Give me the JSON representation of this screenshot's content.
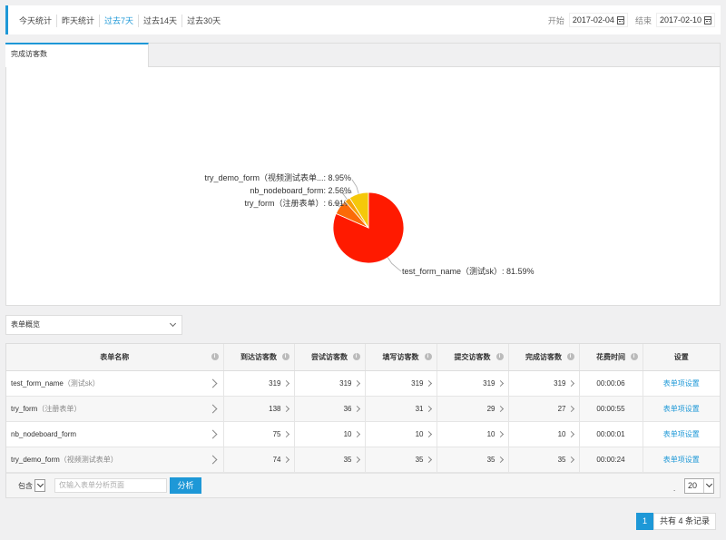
{
  "range_tabs": [
    {
      "label": "今天统计",
      "active": false
    },
    {
      "label": "昨天统计",
      "active": false
    },
    {
      "label": "过去7天",
      "active": true
    },
    {
      "label": "过去14天",
      "active": false
    },
    {
      "label": "过去30天",
      "active": false
    }
  ],
  "date_range": {
    "start_label": "开始",
    "start_value": "2017-02-04",
    "end_label": "结束",
    "end_value": "2017-02-10"
  },
  "chart_tab_label": "完成访客数",
  "chart_data": {
    "type": "pie",
    "slices": [
      {
        "name": "test_form_name（测试sk）",
        "value": 81.59,
        "label": "test_form_name（测试sk）: 81.59%",
        "color": "#ff1a00"
      },
      {
        "name": "try_form（注册表单）",
        "value": 6.91,
        "label": "try_form（注册表单）: 6.91%",
        "color": "#fb6a08"
      },
      {
        "name": "nb_nodeboard_form",
        "value": 2.56,
        "label": "nb_nodeboard_form: 2.56%",
        "color": "#f79f07"
      },
      {
        "name": "try_demo_form（视频测试表单）",
        "value": 8.95,
        "label": "try_demo_form（视频测试表单...: 8.95%",
        "color": "#f5c80a"
      }
    ]
  },
  "table_select": {
    "value": "表单概览"
  },
  "table": {
    "headers": [
      "表单名称",
      "到达访客数",
      "尝试访客数",
      "填写访客数",
      "提交访客数",
      "完成访客数",
      "花费时间",
      "设置"
    ],
    "rows": [
      {
        "name": "test_form_name",
        "tag": "（测试sk）",
        "reach": "319",
        "try": "319",
        "fill": "319",
        "submit": "319",
        "complete": "319",
        "time": "00:00:06",
        "setting": "表单项设置"
      },
      {
        "name": "try_form",
        "tag": "（注册表单）",
        "reach": "138",
        "try": "36",
        "fill": "31",
        "submit": "29",
        "complete": "27",
        "time": "00:00:55",
        "setting": "表单项设置"
      },
      {
        "name": "nb_nodeboard_form",
        "tag": "",
        "reach": "75",
        "try": "10",
        "fill": "10",
        "submit": "10",
        "complete": "10",
        "time": "00:00:01",
        "setting": "表单项设置"
      },
      {
        "name": "try_demo_form",
        "tag": "（视频测试表单）",
        "reach": "74",
        "try": "35",
        "fill": "35",
        "submit": "35",
        "complete": "35",
        "time": "00:00:24",
        "setting": "表单项设置"
      }
    ]
  },
  "filter": {
    "contains_label": "包含",
    "placeholder": "仅输入表单分析页面",
    "analyze_label": "分析",
    "separator": ".",
    "page_size": "20"
  },
  "pagination": {
    "current_page": "1",
    "total_text": "共有 4 条记录"
  }
}
